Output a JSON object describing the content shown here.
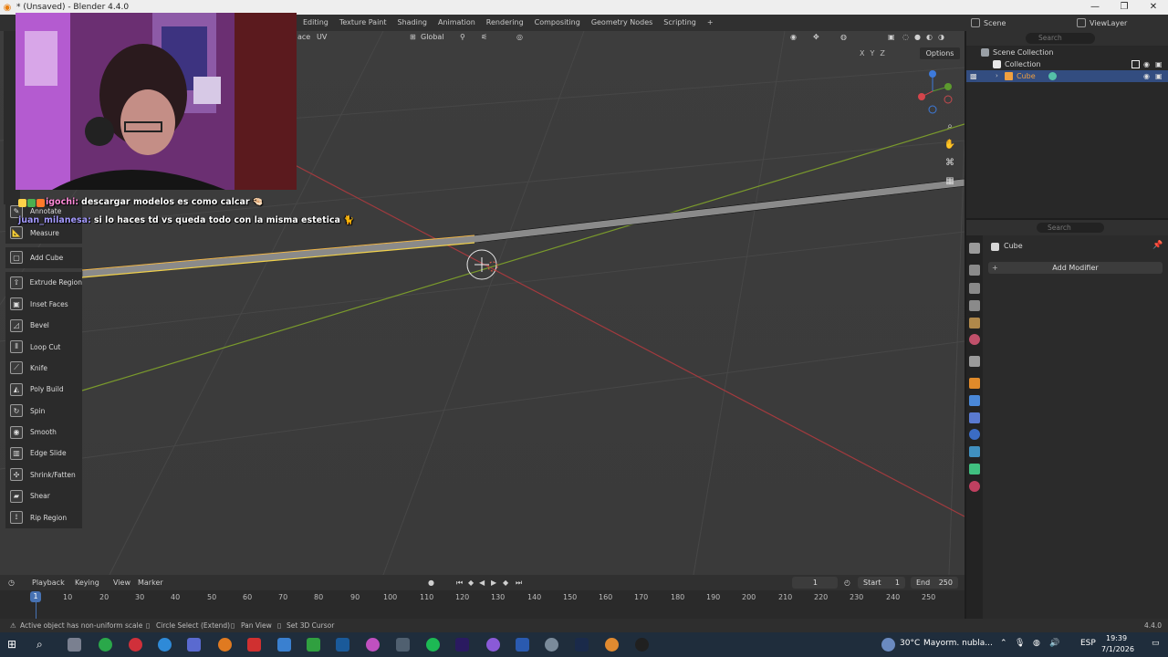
{
  "window": {
    "title": "* (Unsaved) - Blender 4.4.0",
    "minimize": "—",
    "maximize": "❐",
    "close": "✕"
  },
  "workspaces": [
    "Editing",
    "Texture Paint",
    "Shading",
    "Animation",
    "Rendering",
    "Compositing",
    "Geometry Nodes",
    "Scripting"
  ],
  "workspace_add": "+",
  "scene": {
    "label": "Scene",
    "view_layer": "ViewLayer"
  },
  "viewport": {
    "header_face": "ace",
    "header_uv": "UV",
    "orientation": "Global",
    "options": "Options",
    "axes": [
      "X",
      "Y",
      "Z"
    ]
  },
  "chat": [
    {
      "user": "igochi:",
      "message": "descargar modelos es como calcar"
    },
    {
      "user": "juan_milanesa:",
      "message": "si lo haces td vs queda todo con la misma estetica"
    }
  ],
  "tools": [
    "Annotate",
    "Measure",
    "Add Cube",
    "Extrude Region",
    "Inset Faces",
    "Bevel",
    "Loop Cut",
    "Knife",
    "Poly Build",
    "Spin",
    "Smooth",
    "Edge Slide",
    "Shrink/Fatten",
    "Shear",
    "Rip Region"
  ],
  "outliner": {
    "search_placeholder": "Search",
    "scene_collection": "Scene Collection",
    "collection": "Collection",
    "object": "Cube"
  },
  "properties": {
    "search_placeholder": "Search",
    "object_name": "Cube",
    "add_modifier": "Add Modifier"
  },
  "timeline": {
    "menus": [
      "Playback",
      "Keying",
      "View",
      "Marker"
    ],
    "current_frame": "1",
    "start_label": "Start",
    "start": "1",
    "end_label": "End",
    "end": "250",
    "ticks": [
      "10",
      "20",
      "30",
      "40",
      "50",
      "60",
      "70",
      "80",
      "90",
      "100",
      "110",
      "120",
      "130",
      "140",
      "150",
      "160",
      "170",
      "180",
      "190",
      "200",
      "210",
      "220",
      "230",
      "240",
      "250"
    ],
    "playhead": "1"
  },
  "status": {
    "message": "Active object has non-uniform scale",
    "hint1": "Circle Select (Extend)",
    "hint2": "Pan View",
    "hint3": "Set 3D Cursor",
    "version": "4.4.0"
  },
  "taskbar": {
    "weather": "30°C",
    "weather_desc": "Mayorm. nubla...",
    "lang": "ESP",
    "time": "19:39",
    "date": "7/1/2026"
  }
}
